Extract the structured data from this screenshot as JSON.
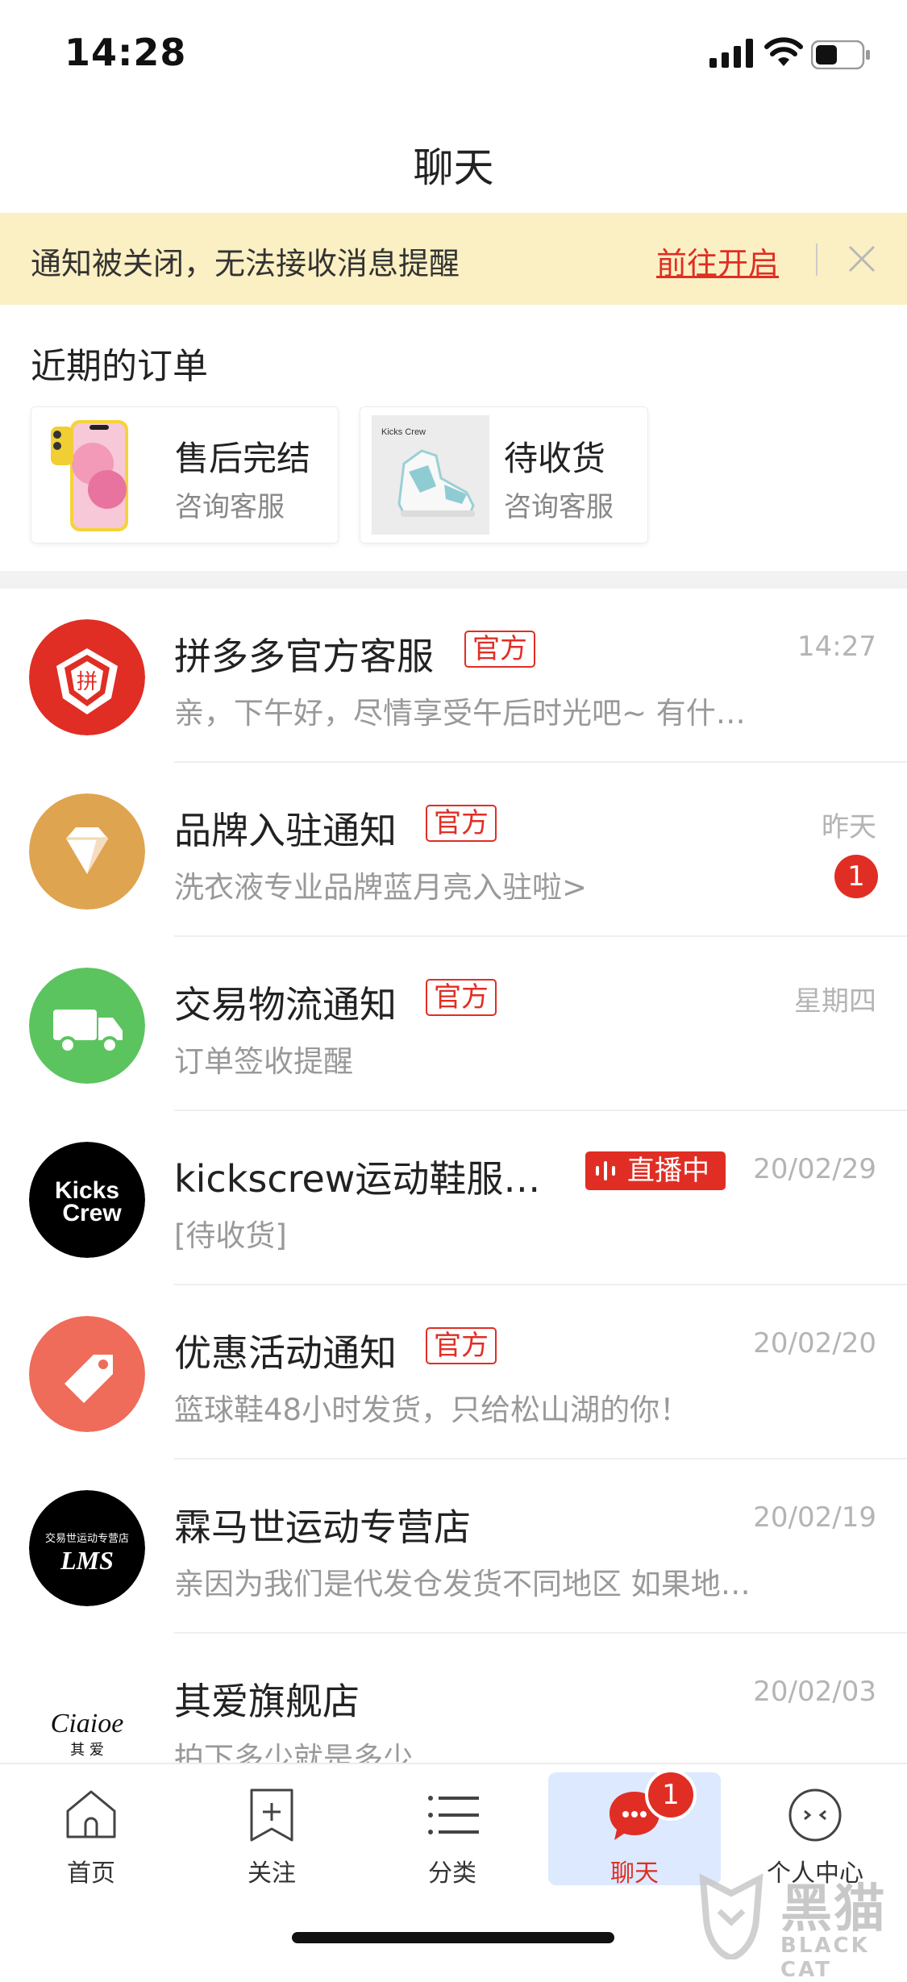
{
  "status_bar": {
    "time": "14:28"
  },
  "nav": {
    "title": "聊天"
  },
  "notice": {
    "text": "通知被关闭，无法接收消息提醒",
    "link": "前往开启"
  },
  "orders": {
    "title": "近期的订单",
    "items": [
      {
        "status": "售后完结",
        "sub": "咨询客服",
        "thumb": "iphone-thumbnail"
      },
      {
        "status": "待收货",
        "sub": "咨询客服",
        "thumb": "sneaker-thumbnail",
        "thumb_text": "Kicks Crew"
      }
    ]
  },
  "chats": [
    {
      "name": "拼多多官方客服",
      "badge": "官方",
      "time": "14:27",
      "preview": "亲，下午好，尽情享受午后时光吧~ 有什…",
      "avatar": "pinduoduo-logo"
    },
    {
      "name": "品牌入驻通知",
      "badge": "官方",
      "time": "昨天",
      "preview": "洗衣液专业品牌蓝月亮入驻啦>",
      "unread": "1",
      "avatar": "diamond-icon"
    },
    {
      "name": "交易物流通知",
      "badge": "官方",
      "time": "星期四",
      "preview": "订单签收提醒",
      "avatar": "truck-icon"
    },
    {
      "name": "kickscrew运动鞋服…",
      "live": "直播中",
      "time": "20/02/29",
      "preview": "[待收货]",
      "avatar": "kickscrew-logo",
      "avatar_text": [
        "Kicks",
        "Crew"
      ]
    },
    {
      "name": "优惠活动通知",
      "badge": "官方",
      "time": "20/02/20",
      "preview": "篮球鞋48小时发货，只给松山湖的你！",
      "avatar": "price-tag-icon"
    },
    {
      "name": "霖马世运动专营店",
      "time": "20/02/19",
      "preview": "亲因为我们是代发仓发货不同地区  如果地…",
      "avatar": "lms-logo",
      "avatar_text": [
        "交易世运动专营店",
        "LMS"
      ]
    },
    {
      "name": "其爱旗舰店",
      "time": "20/02/03",
      "preview": "拍下多少就是多少",
      "avatar": "ciaioe-logo",
      "avatar_text": [
        "Ciaioe",
        "其 爱"
      ]
    }
  ],
  "tabbar": {
    "tabs": [
      {
        "label": "首页",
        "icon": "home-icon"
      },
      {
        "label": "关注",
        "icon": "bookmark-plus-icon"
      },
      {
        "label": "分类",
        "icon": "list-icon"
      },
      {
        "label": "聊天",
        "icon": "chat-bubble-icon",
        "active": true
      },
      {
        "label": "个人中心",
        "icon": "profile-face-icon"
      }
    ],
    "chat_badge": "1"
  },
  "watermark": {
    "text": "黑猫",
    "sub": "BLACK CAT"
  },
  "colors": {
    "accent": "#e02e24",
    "notice_bg": "#fbf0c3",
    "active_tab_bg": "#dce9ff"
  }
}
